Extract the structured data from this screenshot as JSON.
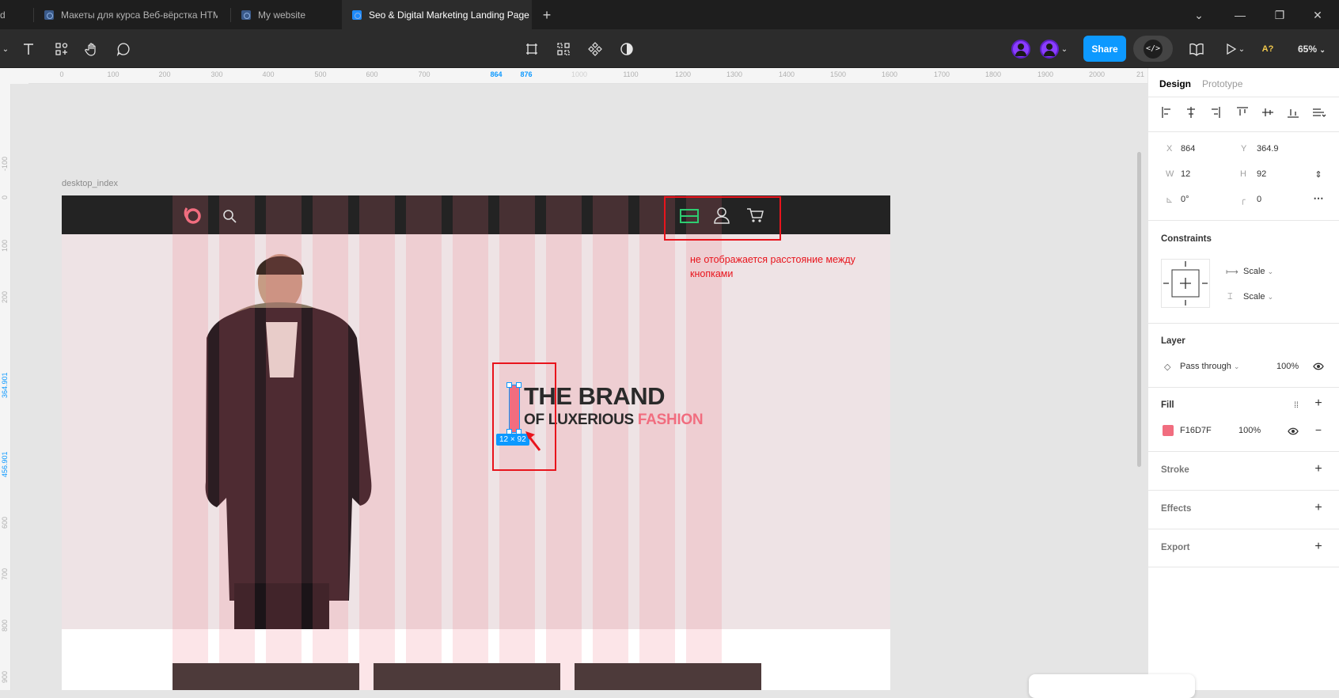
{
  "tabs": [
    {
      "label": "d",
      "active": false
    },
    {
      "label": "Макеты для курса Веб-вёрстка HTML",
      "active": false
    },
    {
      "label": "My website",
      "active": false
    },
    {
      "label": "Seo & Digital Marketing Landing Page",
      "active": true
    }
  ],
  "toolbar": {
    "share_label": "Share",
    "zoom_label": "65%",
    "dev_mode_label": "</>",
    "ai_label": "A?"
  },
  "rulers": {
    "top_ticks": [
      "0",
      "100",
      "200",
      "300",
      "400",
      "500",
      "600",
      "700",
      "864",
      "876",
      "1000",
      "1100",
      "1200",
      "1300",
      "1400",
      "1500",
      "1600",
      "1700",
      "1800",
      "1900",
      "2000",
      "21"
    ],
    "left_ticks": [
      "-100",
      "0",
      "100",
      "200",
      "364.901",
      "456.901",
      "600",
      "700",
      "800",
      "900"
    ]
  },
  "canvas": {
    "frame_label": "desktop_index",
    "headline_line1": "THE BRAND",
    "headline_line2_part1": "OF LUXERIOUS",
    "headline_line2_part2": "FASHION",
    "size_tag": "12 × 92",
    "annotation_note": "не отображается расстояние между кнопками",
    "colors": {
      "accent": "#f16d7f",
      "annotation_red": "#e8141c",
      "header_dark": "#232323",
      "menu_icon_green": "#2ecc71"
    }
  },
  "design_panel": {
    "tab_design": "Design",
    "tab_prototype": "Prototype",
    "x_label": "X",
    "x_value": "864",
    "y_label": "Y",
    "y_value": "364.9",
    "w_label": "W",
    "w_value": "12",
    "h_label": "H",
    "h_value": "92",
    "rotation_value": "0°",
    "radius_value": "0",
    "constraints_title": "Constraints",
    "constraint_h": "Scale",
    "constraint_v": "Scale",
    "layer_title": "Layer",
    "blend_mode": "Pass through",
    "layer_opacity": "100%",
    "fill_title": "Fill",
    "fill_hex": "F16D7F",
    "fill_opacity": "100%",
    "fill_color": "#f16d7f",
    "stroke_title": "Stroke",
    "effects_title": "Effects",
    "export_title": "Export"
  }
}
